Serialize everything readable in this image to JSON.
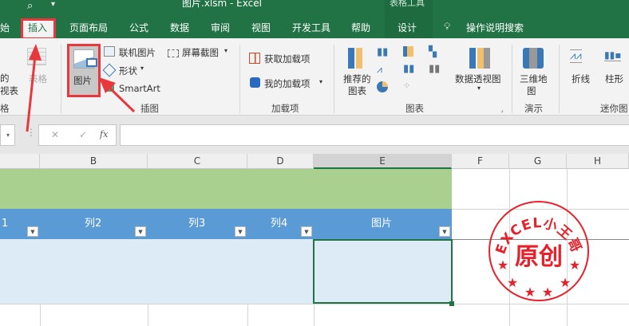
{
  "title": {
    "text": "图片.xlsm  -  Excel",
    "context_group": "表格工具"
  },
  "tabs": [
    "始",
    "插入",
    "页面布局",
    "公式",
    "数据",
    "审阅",
    "视图",
    "开发工具",
    "帮助",
    "设计"
  ],
  "tell_me": "操作说明搜索",
  "ribbon": {
    "left_partial": [
      "的",
      "视表",
      "格"
    ],
    "table": "表格",
    "picture": "图片",
    "online_pictures": "联机图片",
    "shapes": "形状",
    "smartart": "SmartArt",
    "screenshot": "屏幕截图",
    "illustrations_group": "插图",
    "get_addins": "获取加载项",
    "my_addins": "我的加载项",
    "addins_group": "加载项",
    "recommended_charts": [
      "推荐的",
      "图表"
    ],
    "pivot_chart": "数据透视图",
    "charts_group": "图表",
    "map3d": [
      "三维地",
      "图"
    ],
    "tours_group": "演示",
    "line": "折线",
    "column": "柱形",
    "sparklines_group": "迷你图"
  },
  "formula": {
    "cancel": "✕",
    "enter": "✓",
    "fx": "fx",
    "value": ""
  },
  "columns": [
    "B",
    "C",
    "D",
    "E",
    "F",
    "G",
    "H"
  ],
  "table_headers": [
    "1",
    "列2",
    "列3",
    "列4",
    "图片"
  ],
  "stamp": {
    "text": "EXCEL小王哥",
    "center": "原创",
    "color": "#e8202a"
  },
  "colors": {
    "excel_green": "#217346",
    "header_blue": "#5b9bd5",
    "row_blue": "#ddebf7",
    "title_green": "#a9d08e",
    "annotation_red": "#e8383d"
  }
}
